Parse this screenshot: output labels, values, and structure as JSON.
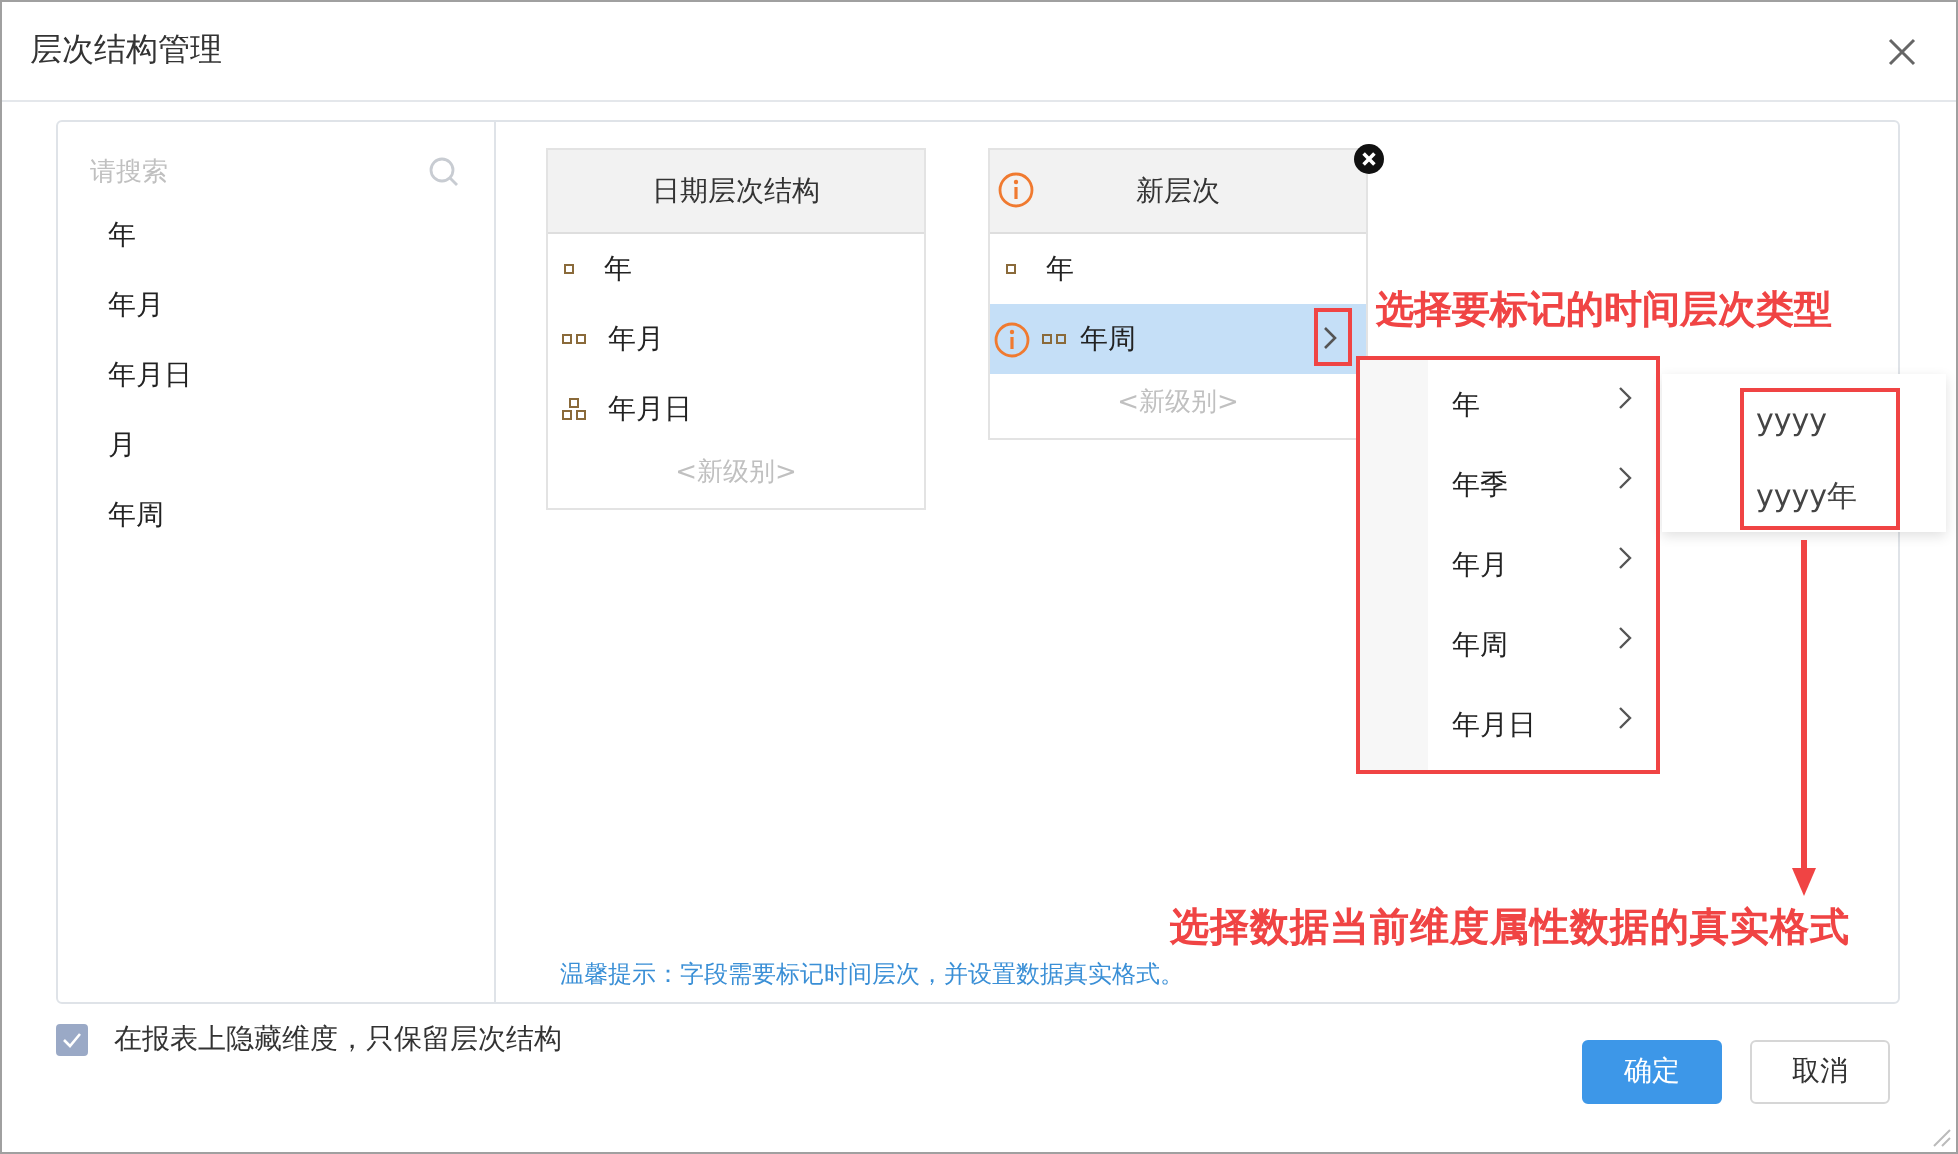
{
  "window": {
    "title": "层次结构管理"
  },
  "search": {
    "placeholder": "请搜索"
  },
  "fields": [
    "年",
    "年月",
    "年月日",
    "月",
    "年周"
  ],
  "hierarchies": [
    {
      "title": "日期层次结构",
      "warning": false,
      "removable": false,
      "add_label": "<新级别>",
      "levels": [
        {
          "label": "年",
          "kind": "single",
          "selected": false,
          "warning": false
        },
        {
          "label": "年月",
          "kind": "double",
          "selected": false,
          "warning": false
        },
        {
          "label": "年月日",
          "kind": "tree",
          "selected": false,
          "warning": false
        }
      ]
    },
    {
      "title": "新层次",
      "warning": true,
      "removable": true,
      "add_label": "<新级别>",
      "levels": [
        {
          "label": "年",
          "kind": "single",
          "selected": false,
          "warning": false
        },
        {
          "label": "年周",
          "kind": "double",
          "selected": true,
          "warning": true
        }
      ]
    }
  ],
  "type_menu": {
    "items": [
      "年",
      "年季",
      "年月",
      "年周",
      "年月日"
    ]
  },
  "format_menu": {
    "items": [
      "yyyy",
      "yyyy年"
    ]
  },
  "hint": "温馨提示：字段需要标记时间层次，并设置数据真实格式。",
  "hide_dimension": {
    "label": "在报表上隐藏维度，只保留层次结构",
    "checked": true
  },
  "buttons": [
    {
      "label": "确定",
      "kind": "primary"
    },
    {
      "label": "取消",
      "kind": "secondary"
    }
  ],
  "annotations": [
    {
      "text": "选择要标记的时间层次类型"
    },
    {
      "text": "选择数据当前维度属性数据的真实格式"
    }
  ]
}
